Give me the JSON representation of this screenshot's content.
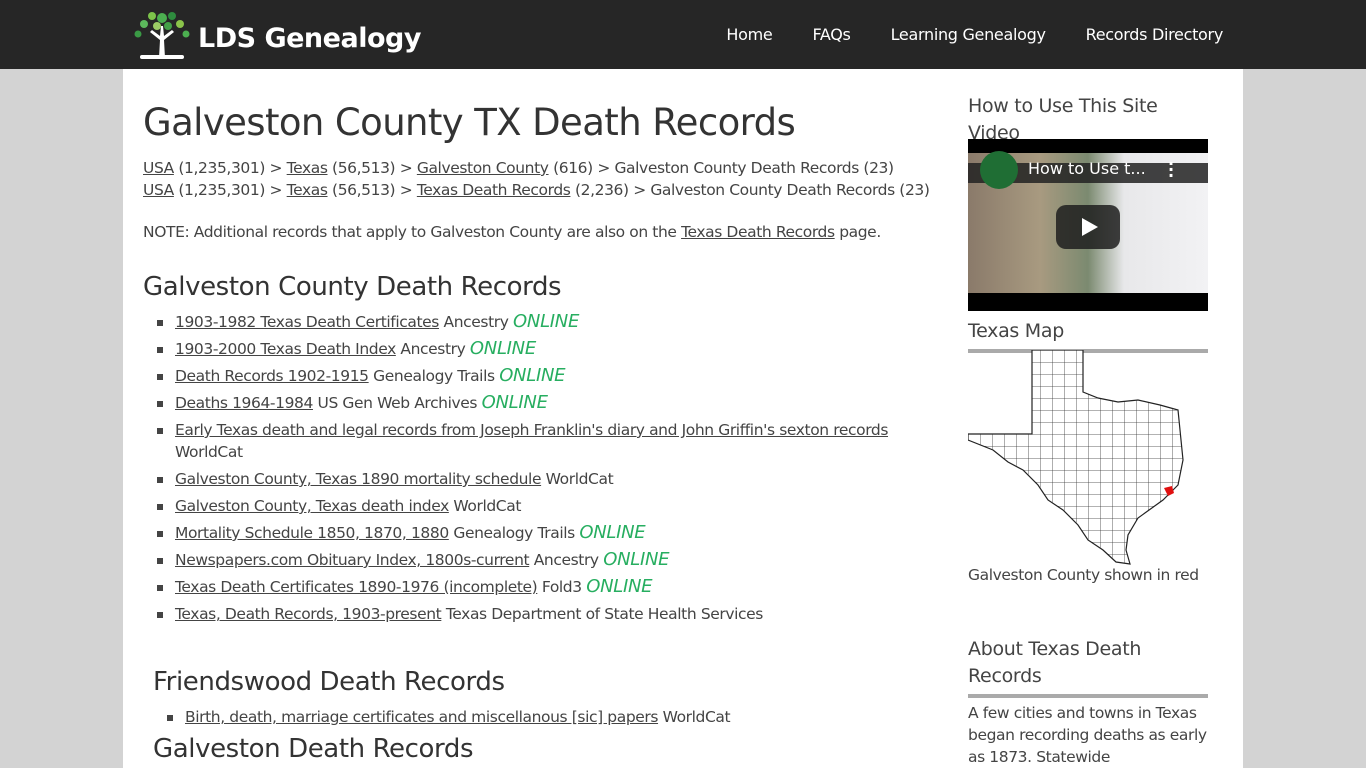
{
  "header": {
    "logo_text": "LDS Genealogy",
    "nav": [
      "Home",
      "FAQs",
      "Learning Genealogy",
      "Records Directory"
    ]
  },
  "page": {
    "title": "Galveston County TX Death Records",
    "breadcrumbs": [
      [
        {
          "link": "USA",
          "count": "(1,235,301)"
        },
        {
          "link": "Texas",
          "count": "(56,513)"
        },
        {
          "link": "Galveston County",
          "count": "(616)"
        },
        {
          "text": "Galveston County Death Records (23)"
        }
      ],
      [
        {
          "link": "USA",
          "count": "(1,235,301)"
        },
        {
          "link": "Texas",
          "count": "(56,513)"
        },
        {
          "link": "Texas Death Records",
          "count": "(2,236)"
        },
        {
          "text": "Galveston County Death Records (23)"
        }
      ]
    ],
    "separator": ">",
    "note": {
      "before": "NOTE: Additional records that apply to Galveston County are also on the",
      "link": "Texas Death Records",
      "after": "page."
    },
    "sections": [
      {
        "heading": "Galveston County Death Records",
        "items": [
          {
            "link": "1903-1982 Texas Death Certificates",
            "source": "Ancestry",
            "online": "ONLINE"
          },
          {
            "link": "1903-2000 Texas Death Index",
            "source": "Ancestry",
            "online": "ONLINE"
          },
          {
            "link": "Death Records 1902-1915",
            "source": "Genealogy Trails",
            "online": "ONLINE"
          },
          {
            "link": "Deaths 1964-1984",
            "source": "US Gen Web Archives",
            "online": "ONLINE"
          },
          {
            "link": "Early Texas death and legal records from Joseph Franklin's diary and John Griffin's sexton records",
            "source": "WorldCat",
            "online": ""
          },
          {
            "link": "Galveston County, Texas 1890 mortality schedule",
            "source": "WorldCat",
            "online": ""
          },
          {
            "link": "Galveston County, Texas death index",
            "source": "WorldCat",
            "online": ""
          },
          {
            "link": "Mortality Schedule 1850, 1870, 1880",
            "source": "Genealogy Trails",
            "online": "ONLINE"
          },
          {
            "link": "Newspapers.com Obituary Index, 1800s-current",
            "source": "Ancestry",
            "online": "ONLINE"
          },
          {
            "link": "Texas Death Certificates 1890-1976 (incomplete)",
            "source": "Fold3",
            "online": "ONLINE"
          },
          {
            "link": "Texas, Death Records, 1903-present",
            "source": "Texas Department of State Health Services",
            "online": ""
          }
        ]
      },
      {
        "heading": "Friendswood Death Records",
        "items": [
          {
            "link": "Birth, death, marriage certificates and miscellanous [sic] papers",
            "source": "WorldCat",
            "online": ""
          }
        ]
      },
      {
        "heading": "Galveston Death Records",
        "items": []
      }
    ]
  },
  "sidebar": {
    "video_heading": "How to Use This Site Video",
    "video_title": "How to Use t...",
    "map_heading": "Texas Map",
    "map_caption": "Galveston County shown in red",
    "about_heading": "About Texas Death Records",
    "about_text": "A few cities and towns in Texas began recording deaths as early as 1873. Statewide"
  },
  "colors": {
    "online": "#27ae60",
    "header_bg": "#262626",
    "highlight_county": "#e01010"
  }
}
